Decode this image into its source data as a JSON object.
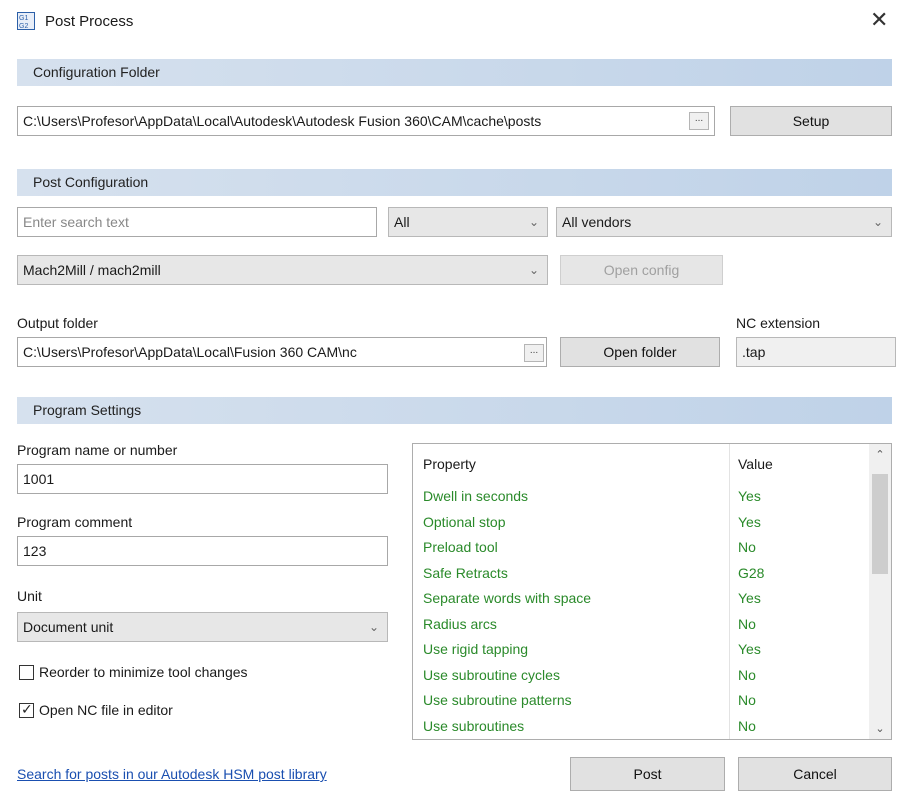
{
  "window": {
    "title": "Post Process"
  },
  "config_folder": {
    "section_label": "Configuration Folder",
    "path": "C:\\Users\\Profesor\\AppData\\Local\\Autodesk\\Autodesk Fusion 360\\CAM\\cache\\posts",
    "browse_label": "...",
    "setup_label": "Setup"
  },
  "post_config": {
    "section_label": "Post Configuration",
    "search_placeholder": "Enter search text",
    "filter_value": "All",
    "vendor_value": "All vendors",
    "post_value": "Mach2Mill / mach2mill",
    "open_config_label": "Open config",
    "output_folder_label": "Output folder",
    "output_folder_path": "C:\\Users\\Profesor\\AppData\\Local\\Fusion 360 CAM\\nc",
    "browse_label": "...",
    "open_folder_label": "Open folder",
    "nc_extension_label": "NC extension",
    "nc_extension_value": ".tap"
  },
  "program_settings": {
    "section_label": "Program Settings",
    "program_name_label": "Program name or number",
    "program_name_value": "1001",
    "program_comment_label": "Program comment",
    "program_comment_value": "123",
    "unit_label": "Unit",
    "unit_value": "Document unit",
    "reorder_label": "Reorder to minimize tool changes",
    "reorder_checked": false,
    "open_nc_label": "Open NC file in editor",
    "open_nc_checked": true
  },
  "properties": {
    "header_property": "Property",
    "header_value": "Value",
    "rows": [
      {
        "name": "Dwell in seconds",
        "value": "Yes"
      },
      {
        "name": "Optional stop",
        "value": "Yes"
      },
      {
        "name": "Preload tool",
        "value": "No"
      },
      {
        "name": "Safe Retracts",
        "value": "G28"
      },
      {
        "name": "Separate words with space",
        "value": "Yes"
      },
      {
        "name": "Radius arcs",
        "value": "No"
      },
      {
        "name": "Use rigid tapping",
        "value": "Yes"
      },
      {
        "name": "Use subroutine cycles",
        "value": "No"
      },
      {
        "name": "Use subroutine patterns",
        "value": "No"
      },
      {
        "name": "Use subroutines",
        "value": "No"
      }
    ]
  },
  "footer": {
    "library_link": "Search for posts in our Autodesk HSM post library",
    "post_label": "Post",
    "cancel_label": "Cancel"
  },
  "icons": {
    "app_icon": "g1-g2-icon",
    "close_icon": "close-icon",
    "dropdown_icon": "chevron-down-icon",
    "check_icon": "check-icon",
    "scroll_up_icon": "chevron-up-icon",
    "scroll_down_icon": "chevron-down-icon"
  },
  "colors": {
    "section_bar": "#bfd2e8",
    "property_text": "#2a8a2a",
    "link": "#1a4fb0"
  }
}
